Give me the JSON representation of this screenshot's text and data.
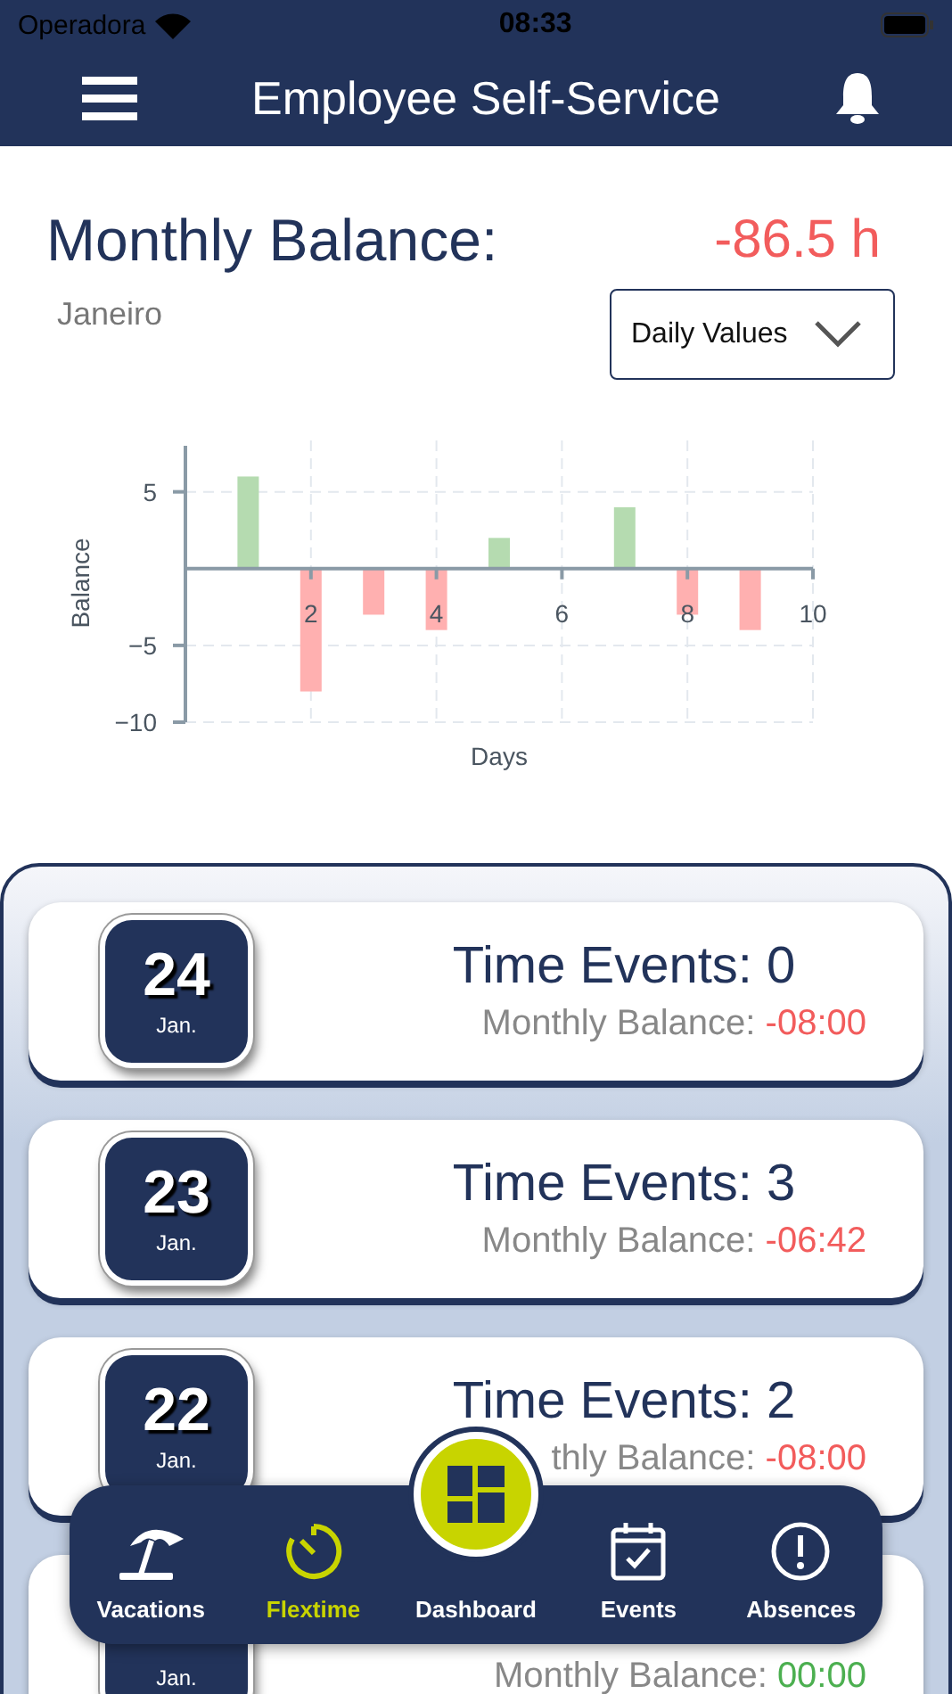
{
  "status_bar": {
    "carrier": "Operadora",
    "time": "08:33"
  },
  "header": {
    "title": "Employee Self-Service"
  },
  "summary": {
    "title": "Monthly Balance:",
    "value": "-86.5 h",
    "month": "Janeiro",
    "dropdown": {
      "value": "Daily Values"
    }
  },
  "chart": {
    "chart_data": {
      "type": "bar",
      "xlabel": "Days",
      "ylabel": "Balance",
      "x": [
        1,
        2,
        3,
        4,
        5,
        6,
        7,
        8,
        9
      ],
      "values": [
        6,
        -8,
        -3,
        -4,
        2,
        null,
        4,
        -3,
        -4
      ],
      "xlim": [
        0,
        10
      ],
      "ylim": [
        -10,
        8
      ],
      "xticks": [
        2,
        4,
        6,
        8,
        10
      ],
      "yticks": [
        {
          "value": -10,
          "label": "−10"
        },
        {
          "value": -5,
          "label": "−5"
        },
        5
      ],
      "grid": true
    }
  },
  "days": [
    {
      "day": "24",
      "month": "Jan.",
      "title": "Time Events: 0",
      "balance_label": "Monthly Balance:",
      "balance": "-08:00",
      "color": "#f25c5c"
    },
    {
      "day": "23",
      "month": "Jan.",
      "title": "Time Events: 3",
      "balance_label": "Monthly Balance:",
      "balance": "-06:42",
      "color": "#f25c5c"
    },
    {
      "day": "22",
      "month": "Jan.",
      "title": "Time Events: 2",
      "balance_label": "thly Balance:",
      "balance": "-08:00",
      "color": "#f25c5c"
    },
    {
      "month": "Jan.",
      "balance_label": "Monthly Balance:",
      "balance": "00:00",
      "color": "#4caf50"
    }
  ],
  "tab_bar": [
    {
      "kind": "vacations",
      "label": "Vacations",
      "selected": false
    },
    {
      "kind": "flextime",
      "label": "Flextime",
      "selected": true
    },
    {
      "kind": "dashboard",
      "label": "Dashboard",
      "selected": false
    },
    {
      "kind": "events",
      "label": "Events",
      "selected": false
    },
    {
      "kind": "absences",
      "label": "Absences",
      "selected": false
    }
  ]
}
